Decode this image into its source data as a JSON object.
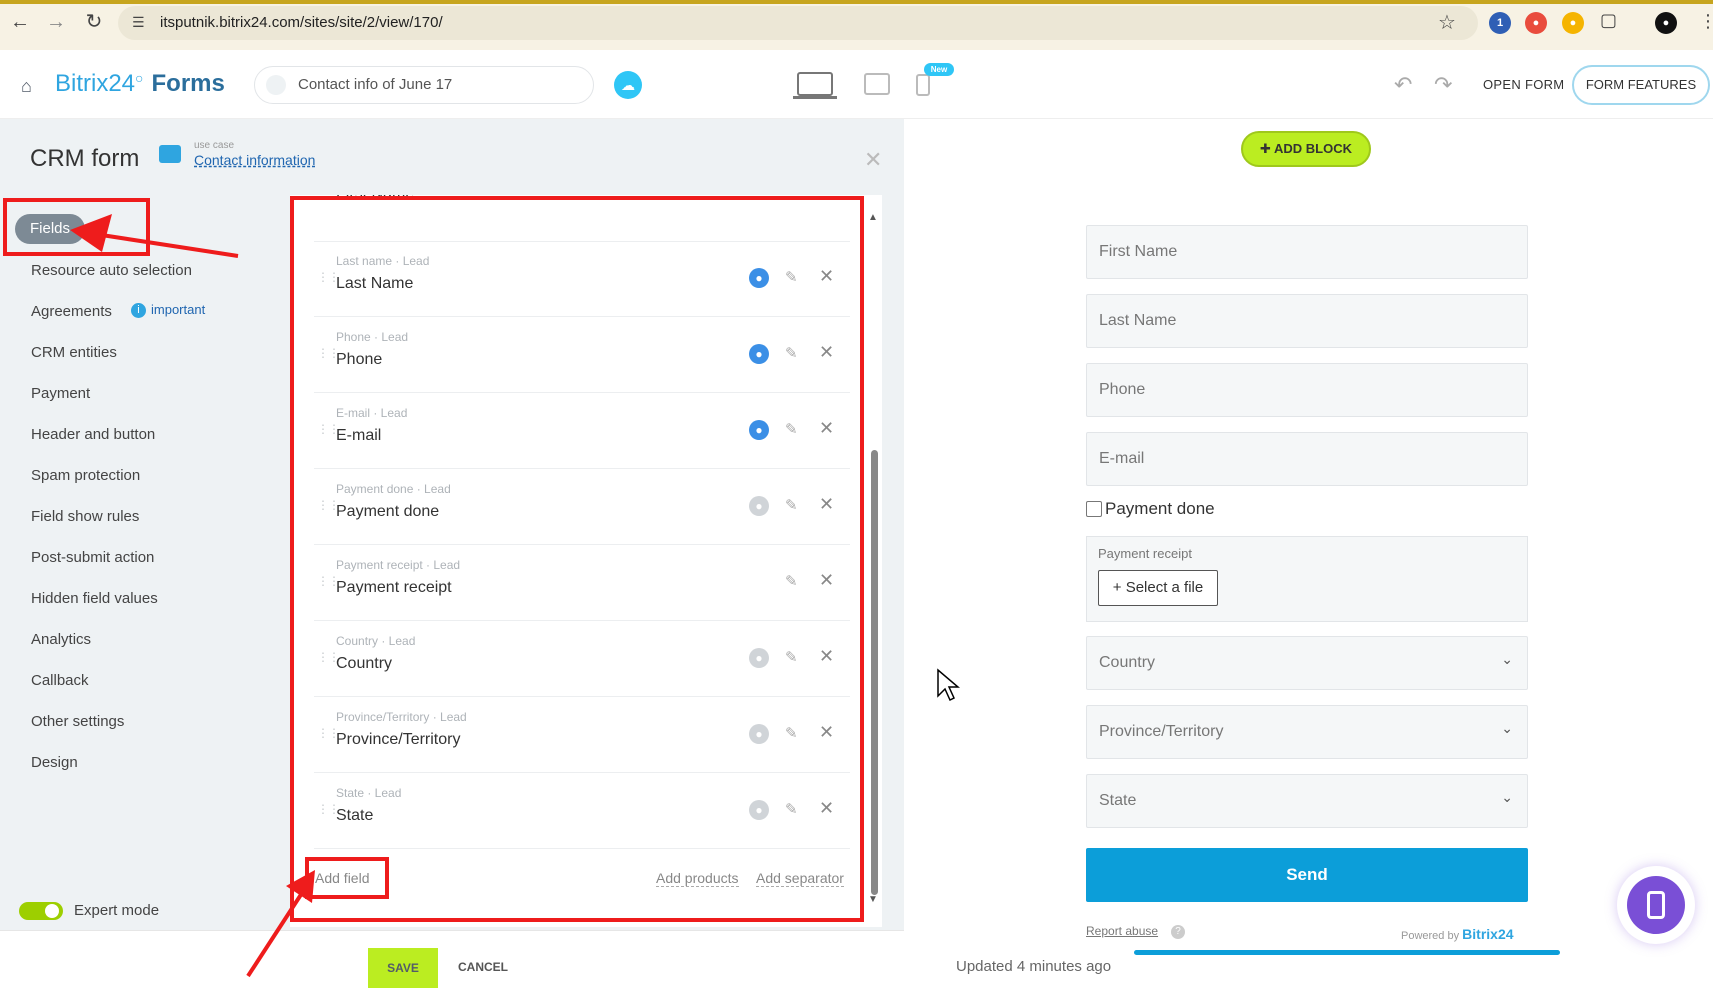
{
  "browser": {
    "url": "itsputnik.bitrix24.com/sites/site/2/view/170/"
  },
  "header": {
    "brand": "Bitrix24",
    "brand_suffix": "Forms",
    "form_name": "Contact info of June 17",
    "new_badge": "New",
    "open_form": "OPEN FORM",
    "form_features": "FORM FEATURES"
  },
  "sidebar": {
    "title": "CRM form",
    "use_case_label": "use case",
    "use_case_link": "Contact information",
    "items": [
      {
        "label": "Fields"
      },
      {
        "label": "Resource auto selection"
      },
      {
        "label": "Agreements"
      },
      {
        "label": "CRM entities"
      },
      {
        "label": "Payment"
      },
      {
        "label": "Header and button"
      },
      {
        "label": "Spam protection"
      },
      {
        "label": "Field show rules"
      },
      {
        "label": "Post-submit action"
      },
      {
        "label": "Hidden field values"
      },
      {
        "label": "Analytics"
      },
      {
        "label": "Callback"
      },
      {
        "label": "Other settings"
      },
      {
        "label": "Design"
      }
    ],
    "important": "important",
    "expert_mode": "Expert mode"
  },
  "fields_list": {
    "first_name_partial": "First Name",
    "rows": [
      {
        "sub": "Last name · Lead",
        "label": "Last Name",
        "crm": "active"
      },
      {
        "sub": "Phone · Lead",
        "label": "Phone",
        "crm": "active"
      },
      {
        "sub": "E-mail · Lead",
        "label": "E-mail",
        "crm": "active"
      },
      {
        "sub": "Payment done · Lead",
        "label": "Payment done",
        "crm": "inactive"
      },
      {
        "sub": "Payment receipt · Lead",
        "label": "Payment receipt",
        "crm": "none"
      },
      {
        "sub": "Country · Lead",
        "label": "Country",
        "crm": "inactive"
      },
      {
        "sub": "Province/Territory · Lead",
        "label": "Province/Territory",
        "crm": "inactive"
      },
      {
        "sub": "State · Lead",
        "label": "State",
        "crm": "inactive"
      }
    ],
    "add_field": "Add field",
    "add_products": "Add products",
    "add_separator": "Add separator"
  },
  "bottom": {
    "save": "SAVE",
    "cancel": "CANCEL"
  },
  "preview": {
    "add_block": "ADD BLOCK",
    "first_name": "First Name",
    "last_name": "Last Name",
    "phone": "Phone",
    "email": "E-mail",
    "payment_done": "Payment done",
    "payment_receipt": "Payment receipt",
    "select_file": "Select a file",
    "country": "Country",
    "province": "Province/Territory",
    "state": "State",
    "send": "Send",
    "report_abuse": "Report abuse",
    "powered_by": "Powered by",
    "powered_brand": "Bitrix",
    "powered_num": "24",
    "updated": "Updated 4 minutes ago"
  },
  "colors": {
    "accent": "#2fc6f6",
    "send": "#0c9ed9",
    "save": "#bbed21",
    "annotation": "#ee1c1c",
    "crm_active": "#3b8fe6",
    "crm_inactive": "#d0d4d8"
  }
}
